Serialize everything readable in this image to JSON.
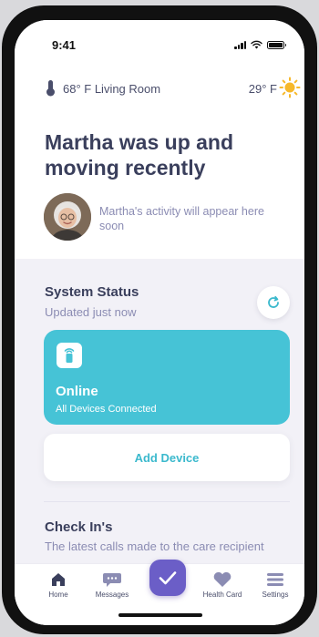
{
  "status_bar": {
    "time": "9:41"
  },
  "weather": {
    "indoor": "68° F Living Room",
    "outdoor": "29° F"
  },
  "hero": {
    "headline": "Martha was up and moving recently",
    "activity_note": "Martha's activity will appear here soon"
  },
  "system_status": {
    "title": "System Status",
    "updated": "Updated just now",
    "card_title": "Online",
    "card_subtitle": "All Devices Connected",
    "add_device_label": "Add Device"
  },
  "check_ins": {
    "title": "Check In's",
    "subtitle": "The latest calls made to the care recipient"
  },
  "tabs": [
    {
      "label": "Home",
      "icon": "home-icon"
    },
    {
      "label": "Messages",
      "icon": "chat-icon"
    },
    {
      "label": "Health Card",
      "icon": "heart-icon"
    },
    {
      "label": "Settings",
      "icon": "menu-icon"
    }
  ],
  "colors": {
    "accent_teal": "#46c3d6",
    "accent_purple": "#6b5ec7",
    "heading": "#3a3f5c",
    "muted": "#8b8cb3"
  }
}
